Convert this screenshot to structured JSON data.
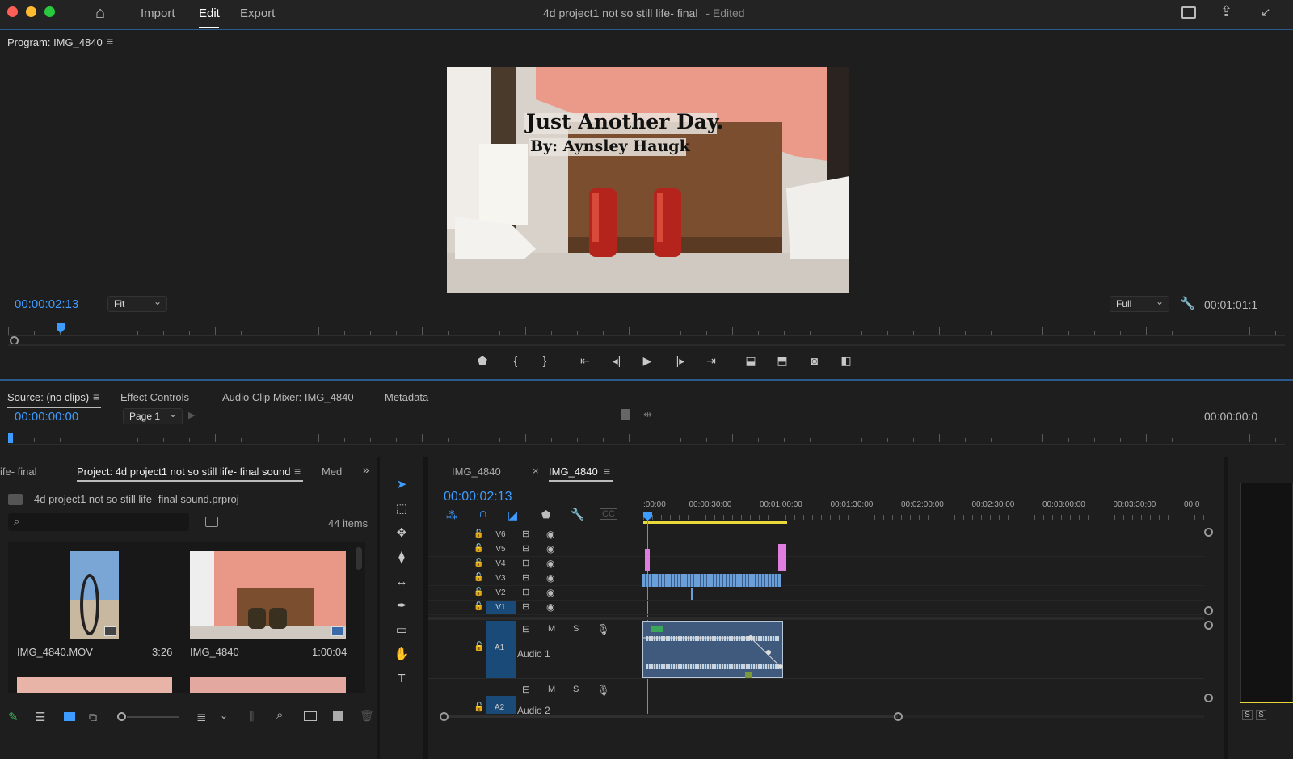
{
  "app": {
    "menu": [
      "Import",
      "Edit",
      "Export"
    ],
    "project_title": "4d project1 not so still life- final",
    "edited_status": "- Edited"
  },
  "program": {
    "panel_title": "Program: IMG_4840",
    "timecode": "00:00:02:13",
    "zoom": "Fit",
    "resolution": "Full",
    "duration": "00:01:01:1",
    "video_title": "Just Another Day.",
    "video_byline": "By: Aynsley Haugk",
    "playhead_fraction": 0.04
  },
  "source": {
    "tabs": [
      "Source: (no clips)",
      "Effect Controls",
      "Audio Clip Mixer: IMG_4840",
      "Metadata"
    ],
    "timecode": "00:00:00:00",
    "page": "Page 1",
    "right_timecode": "00:00:00:0"
  },
  "project": {
    "prev_tab": "ife- final",
    "tab": "Project: 4d project1 not so still life- final sound",
    "next_tab": "Med",
    "file": "4d project1 not so still life- final sound.prproj",
    "search_placeholder": "",
    "items_count": "44 items",
    "clips": [
      {
        "name": "IMG_4840.MOV",
        "duration": "3:26"
      },
      {
        "name": "IMG_4840",
        "duration": "1:00:04"
      }
    ]
  },
  "timeline": {
    "tabs": [
      "IMG_4840",
      "IMG_4840"
    ],
    "timecode": "00:00:02:13",
    "ruler_labels": [
      ":00:00",
      "00:00:30:00",
      "00:01:00:00",
      "00:01:30:00",
      "00:02:00:00",
      "00:02:30:00",
      "00:03:00:00",
      "00:03:30:00",
      "00:0"
    ],
    "video_tracks": [
      "V6",
      "V5",
      "V4",
      "V3",
      "V2",
      "V1"
    ],
    "audio_tracks": [
      {
        "id": "A1",
        "name": "Audio 1"
      },
      {
        "id": "A2",
        "name": "Audio 2"
      }
    ],
    "track_buttons": {
      "mute": "M",
      "solo": "S"
    }
  },
  "right_panel": {
    "buttons": [
      "S",
      "S"
    ]
  },
  "colors": {
    "accent": "#3e9bff",
    "clip_blue": "#6a9fd8",
    "clip_pink": "#e07de0",
    "audio_clip": "#3f5a7c",
    "work_area": "#e8d83a"
  }
}
